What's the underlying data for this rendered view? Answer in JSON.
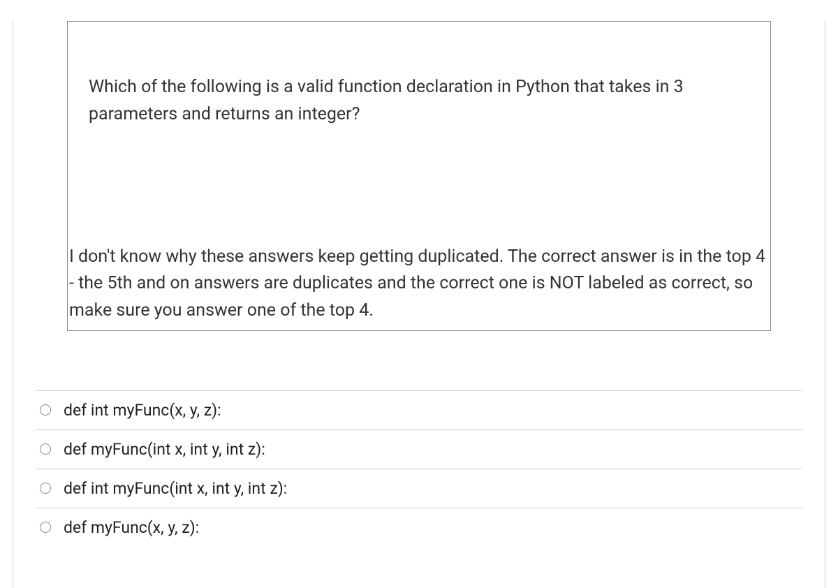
{
  "question": {
    "prompt": "Which of the following is a valid function declaration in Python that takes in 3 parameters and returns an integer?",
    "note": "I don't know why these answers keep getting duplicated. The correct answer is in the top 4 - the 5th and on answers are duplicates and the correct one is NOT labeled as correct, so make sure you answer one of the top 4."
  },
  "options": [
    {
      "label": "def int myFunc(x, y, z):"
    },
    {
      "label": "def myFunc(int x, int y, int z):"
    },
    {
      "label": "def int myFunc(int x, int y, int z):"
    },
    {
      "label": "def myFunc(x, y, z):"
    }
  ]
}
